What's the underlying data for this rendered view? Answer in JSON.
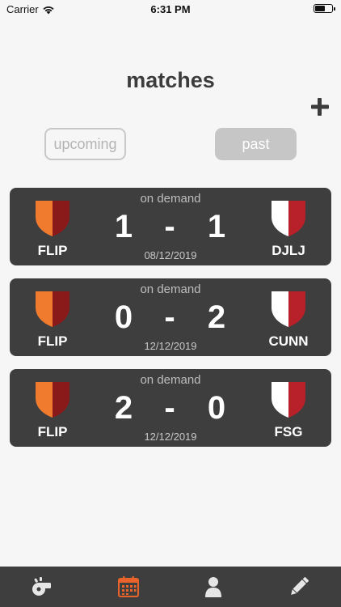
{
  "status_bar": {
    "carrier": "Carrier",
    "time": "6:31 PM",
    "battery_level": 0.65
  },
  "header": {
    "title": "matches",
    "add_icon": "plus-icon"
  },
  "segments": {
    "upcoming_label": "upcoming",
    "past_label": "past",
    "selected": "past"
  },
  "colors": {
    "home_shield_light": "#f07a2d",
    "home_shield_dark": "#8a1a1a",
    "away_shield_light": "#ffffff",
    "away_shield_dark": "#b8202a",
    "card_bg": "#3e3e3e",
    "tab_active": "#e8642a",
    "tab_inactive": "#e6e6e6"
  },
  "matches": [
    {
      "status": "on demand",
      "home": "FLIP",
      "away": "DJLJ",
      "home_score": "1",
      "separator": "-",
      "away_score": "1",
      "date": "08/12/2019"
    },
    {
      "status": "on demand",
      "home": "FLIP",
      "away": "CUNN",
      "home_score": "0",
      "separator": "-",
      "away_score": "2",
      "date": "12/12/2019"
    },
    {
      "status": "on demand",
      "home": "FLIP",
      "away": "FSG",
      "home_score": "2",
      "separator": "-",
      "away_score": "0",
      "date": "12/12/2019"
    }
  ],
  "tab_bar": {
    "tabs": [
      {
        "icon": "whistle-icon",
        "active": false
      },
      {
        "icon": "calendar-icon",
        "active": true
      },
      {
        "icon": "person-icon",
        "active": false
      },
      {
        "icon": "pencil-icon",
        "active": false
      }
    ]
  }
}
